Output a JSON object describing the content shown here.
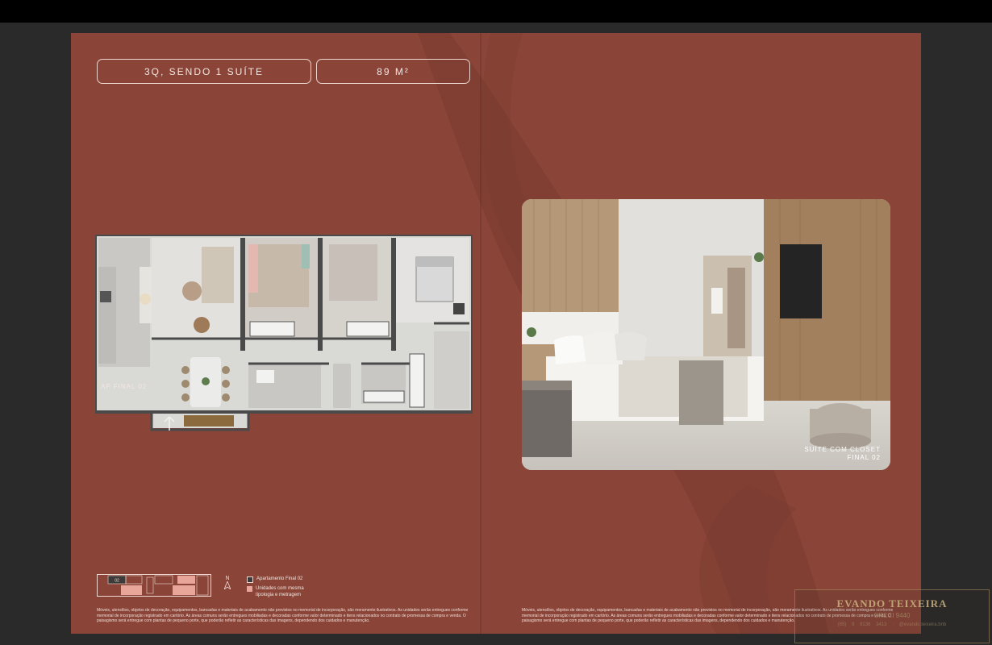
{
  "header": {
    "suites": "3Q, SENDO 1 SUÍTE",
    "area": "89 M²"
  },
  "floorplan": {
    "label": "AP FINAL 02"
  },
  "keyplan": {
    "unit_number": "02",
    "north": "N",
    "legend": [
      {
        "label": "Apartamento Final 02",
        "color": "#3d3b39"
      },
      {
        "label": "Unidades com mesma tipologia e metragem",
        "color": "#e8a59a"
      }
    ]
  },
  "photo": {
    "caption_line1": "SUÍTE COM CLOSET",
    "caption_line2": "FINAL 02"
  },
  "disclaimer": "Móveis, utensílios, objetos de decoração, equipamentos, bancadas e materiais de acabamento não previstos no memorial de incorporação, são meramente ilustrativos. As unidades serão entregues conforme memorial de incorporação registrado em cartório. As áreas comuns serão entregues mobiliadas e decoradas conforme valor determinado e itens relacionados no contrato de promessa de compra e venda. O paisagismo será entregue com plantas de pequeno porte, que poderão refletir as características das imagens, dependendo dos cuidados e manutenção.",
  "watermark": {
    "name": "EVANDO TEIXEIRA",
    "creci": "CRECI 9440",
    "contact": "(85) 9 8136 3413 · @evando.teixeira.bnb"
  },
  "colors": {
    "background": "#8a4538",
    "frame": "#2a2a2a",
    "accent": "#e8a59a",
    "text": "#f3e6e1"
  }
}
